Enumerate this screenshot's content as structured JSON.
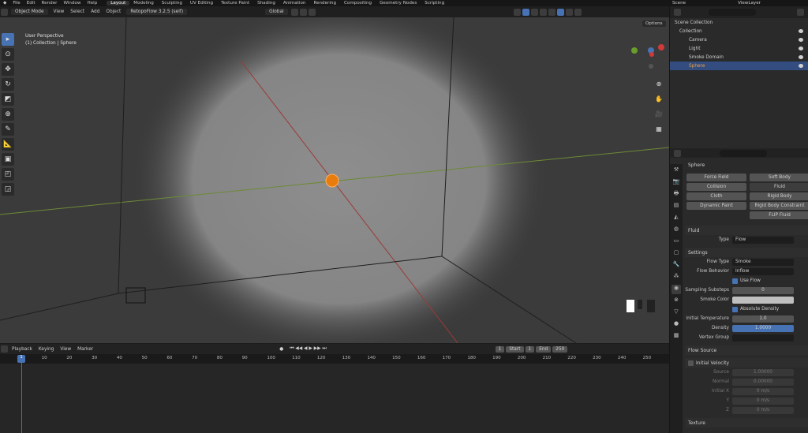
{
  "menu": [
    "File",
    "Edit",
    "Render",
    "Window",
    "Help"
  ],
  "workspaces": [
    {
      "label": "Layout",
      "active": true
    },
    {
      "label": "Modeling"
    },
    {
      "label": "Sculpting"
    },
    {
      "label": "UV Editing"
    },
    {
      "label": "Texture Paint"
    },
    {
      "label": "Shading"
    },
    {
      "label": "Animation"
    },
    {
      "label": "Rendering"
    },
    {
      "label": "Compositing"
    },
    {
      "label": "Geometry Nodes"
    },
    {
      "label": "Scripting"
    }
  ],
  "scene_label": "Scene",
  "viewlayer_label": "ViewLayer",
  "viewport_header": {
    "mode": "Object Mode",
    "menus": [
      "View",
      "Select",
      "Add",
      "Object"
    ],
    "addon": "RetopoFlow 3.2.5 (self)",
    "transform": "Global"
  },
  "viewport": {
    "perspective": "User Perspective",
    "collection": "(1) Collection | Sphere",
    "options": "Options"
  },
  "timeline": {
    "menus": [
      "Playback",
      "Keying",
      "View",
      "Marker"
    ],
    "current_frame": "1",
    "start_label": "Start",
    "start": "1",
    "end_label": "End",
    "end": "250",
    "ruler": [
      "1",
      "10",
      "20",
      "30",
      "40",
      "50",
      "60",
      "70",
      "80",
      "90",
      "100",
      "110",
      "120",
      "130",
      "140",
      "150",
      "160",
      "170",
      "180",
      "190",
      "200",
      "210",
      "220",
      "230",
      "240",
      "250"
    ]
  },
  "outliner": {
    "root": "Scene Collection",
    "collection": "Collection",
    "items": [
      {
        "name": "Camera",
        "selected": false
      },
      {
        "name": "Light",
        "selected": false
      },
      {
        "name": "Smoke Domain",
        "selected": false
      },
      {
        "name": "Sphere",
        "selected": true
      }
    ]
  },
  "properties": {
    "object_name": "Sphere",
    "physics_buttons": [
      "Force Field",
      "Soft Body",
      "Collision",
      "Fluid",
      "Cloth",
      "Rigid Body",
      "Dynamic Paint",
      "Rigid Body Constraint",
      "FLIP Fluid"
    ],
    "fluid_panel": "Fluid",
    "type_label": "Type",
    "type_value": "Flow",
    "settings_panel": "Settings",
    "flow_type_label": "Flow Type",
    "flow_type": "Smoke",
    "flow_behavior_label": "Flow Behavior",
    "flow_behavior": "Inflow",
    "use_flow": "Use Flow",
    "sampling_label": "Sampling Substeps",
    "sampling_value": "0",
    "smoke_color_label": "Smoke Color",
    "absolute_density": "Absolute Density",
    "init_temp_label": "Initial Temperature",
    "init_temp": "1.0",
    "density_label": "Density",
    "density": "1.0000",
    "vertex_group_label": "Vertex Group",
    "flow_source": "Flow Source",
    "initial_velocity": "Initial Velocity",
    "source_label": "Source",
    "source_value": "1.00000",
    "normal_label": "Normal",
    "normal_value": "0.00000",
    "initial_x_label": "Initial X",
    "initial_x": "0 m/s",
    "y_label": "Y",
    "y_value": "0 m/s",
    "z_label": "Z",
    "z_value": "0 m/s",
    "texture": "Texture"
  },
  "colors": {
    "accent": "#4772b3",
    "selected_row": "#334d80",
    "orange": "#e87d0d"
  }
}
